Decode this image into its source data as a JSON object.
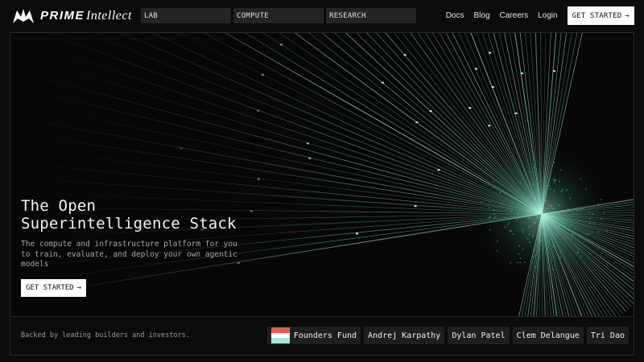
{
  "brand": {
    "name_bold": "PRIME",
    "name_light": "Intellect"
  },
  "nav": {
    "tabs": [
      {
        "label": "LAB"
      },
      {
        "label": "COMPUTE"
      },
      {
        "label": "RESEARCH"
      }
    ],
    "links": [
      {
        "label": "Docs"
      },
      {
        "label": "Blog"
      },
      {
        "label": "Careers"
      },
      {
        "label": "Login"
      }
    ],
    "cta": "GET STARTED",
    "cta_arrow": "→"
  },
  "hero": {
    "title_line1": "The Open",
    "title_line2": "Superintelligence Stack",
    "subtitle": "The compute and infrastructure platform for you to train, evaluate, and deploy your own agentic models",
    "cta": "GET STARTED",
    "cta_arrow": "→"
  },
  "footer": {
    "backed_text": "Backed by leading builders and investors.",
    "investors": [
      {
        "name": "Founders Fund",
        "icon": "founders-fund-flag"
      },
      {
        "name": "Andrej Karpathy"
      },
      {
        "name": "Dylan Patel"
      },
      {
        "name": "Clem Delangue"
      },
      {
        "name": "Tri Dao"
      }
    ]
  },
  "colors": {
    "background": "#0b0b0b",
    "accent_teal": "#7ff0d0",
    "tab_bg": "#242424",
    "flag_red": "#e85a4f",
    "flag_teal": "#9fe6dc"
  }
}
